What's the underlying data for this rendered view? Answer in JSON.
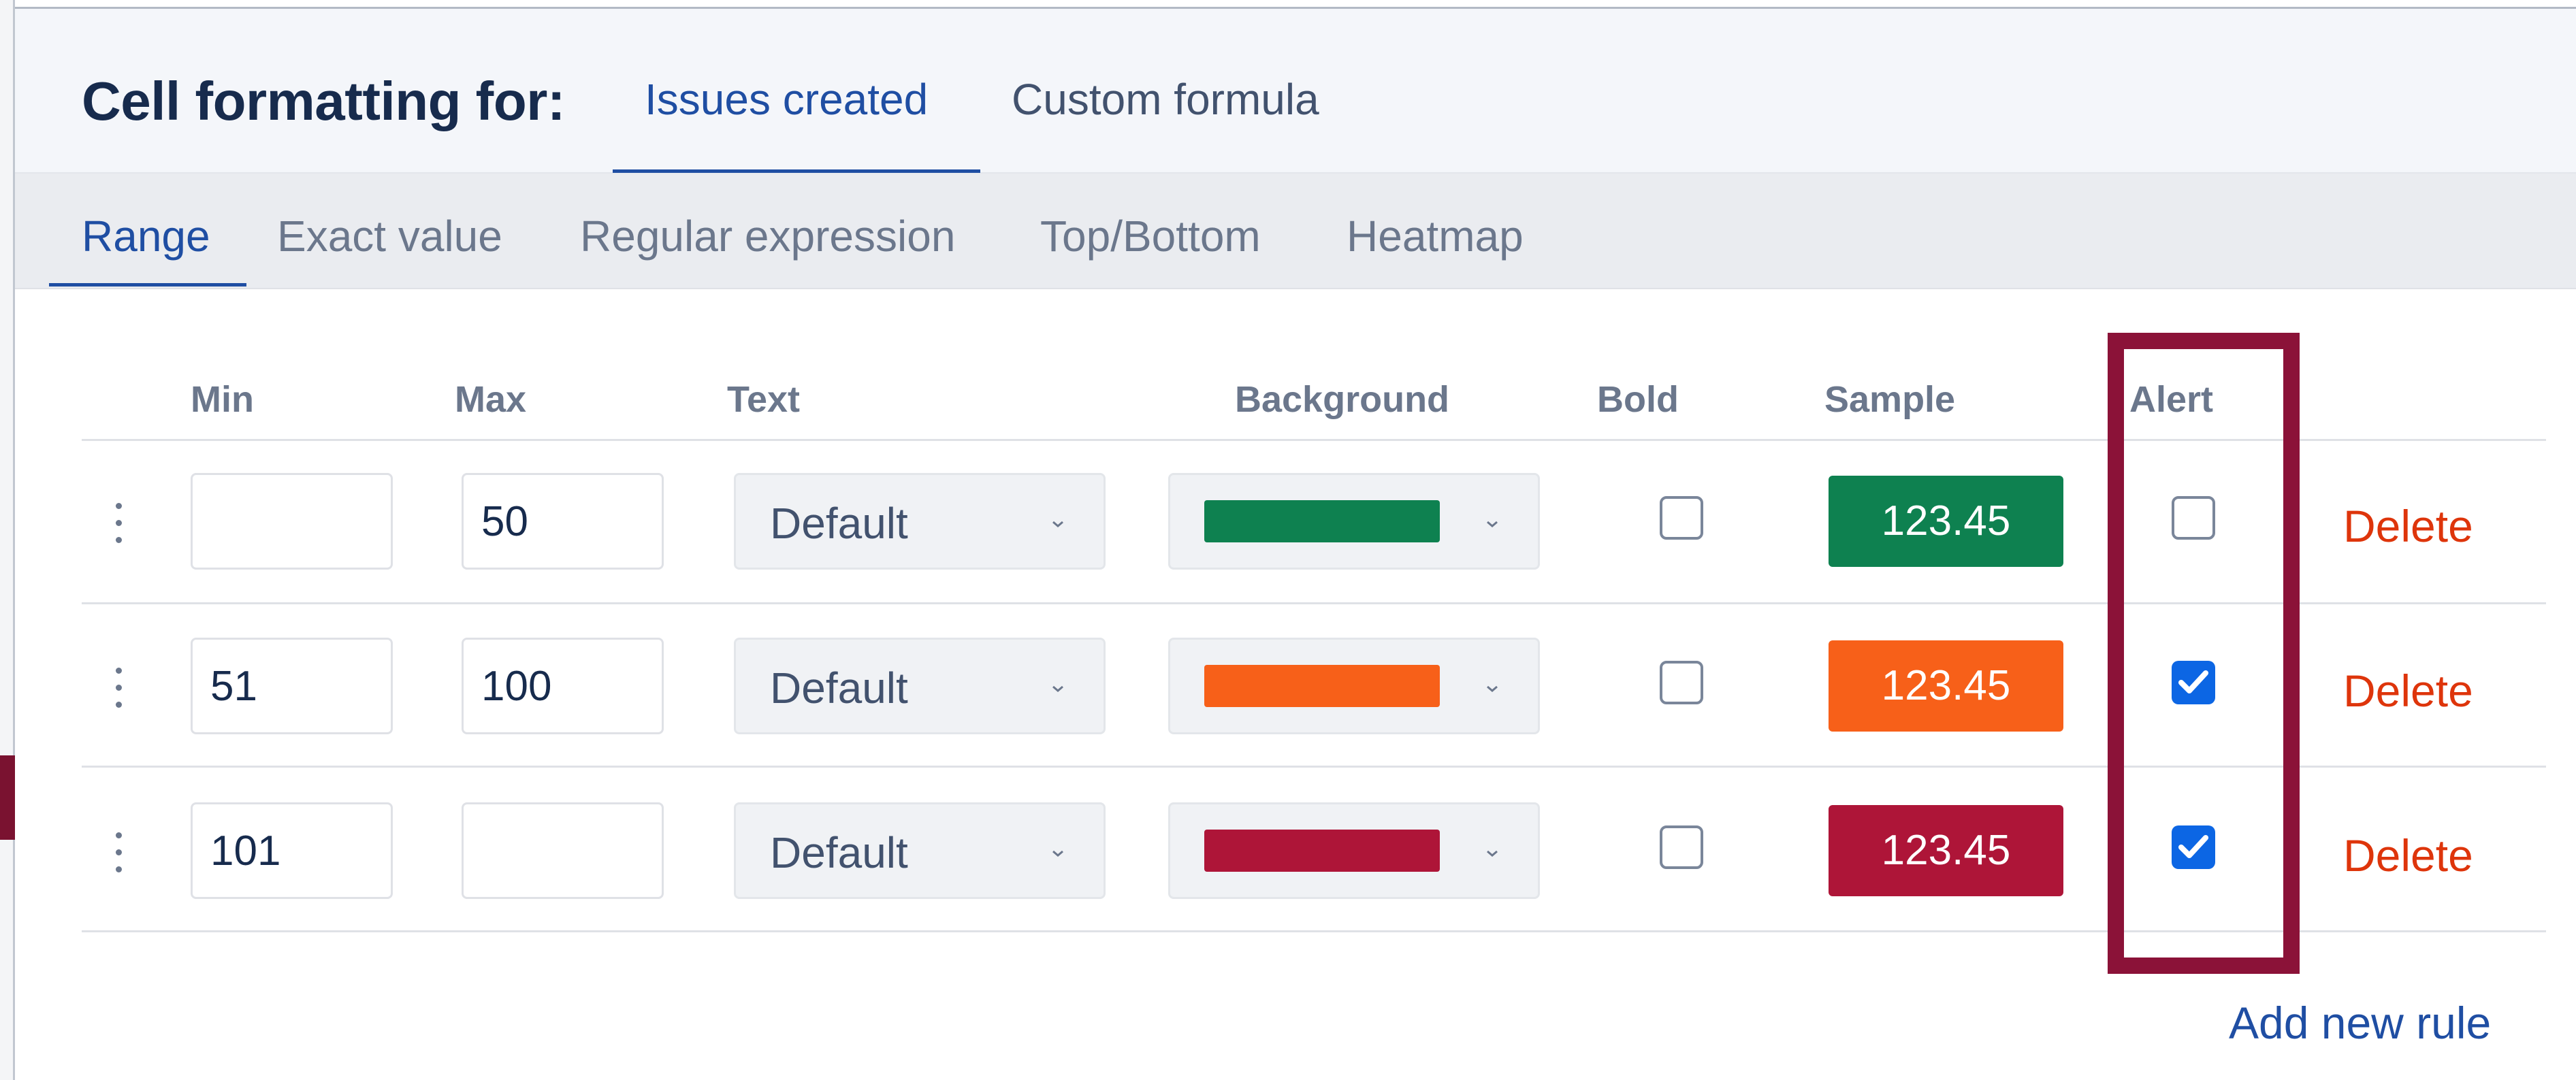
{
  "header": {
    "title": "Cell formatting for:",
    "tabs": [
      {
        "label": "Issues created",
        "active": true
      },
      {
        "label": "Custom formula",
        "active": false
      }
    ]
  },
  "subtabs": [
    {
      "label": "Range",
      "active": true
    },
    {
      "label": "Exact value",
      "active": false
    },
    {
      "label": "Regular expression",
      "active": false
    },
    {
      "label": "Top/Bottom",
      "active": false
    },
    {
      "label": "Heatmap",
      "active": false
    }
  ],
  "table": {
    "columns": {
      "min": "Min",
      "max": "Max",
      "text": "Text",
      "background": "Background",
      "bold": "Bold",
      "sample": "Sample",
      "alert": "Alert"
    },
    "rows": [
      {
        "min": "",
        "max": "50",
        "text": "Default",
        "background_color": "#0e8150",
        "bold": false,
        "sample": "123.45",
        "alert": false,
        "delete": "Delete"
      },
      {
        "min": "51",
        "max": "100",
        "text": "Default",
        "background_color": "#f76019",
        "bold": false,
        "sample": "123.45",
        "alert": true,
        "delete": "Delete"
      },
      {
        "min": "101",
        "max": "",
        "text": "Default",
        "background_color": "#ae1538",
        "bold": false,
        "sample": "123.45",
        "alert": true,
        "delete": "Delete"
      }
    ]
  },
  "add_rule": "Add new rule",
  "colors": {
    "accent": "#1f4ea3",
    "delete": "#de350b",
    "checkbox_checked": "#0c66e4",
    "highlight": "#8b1238"
  }
}
